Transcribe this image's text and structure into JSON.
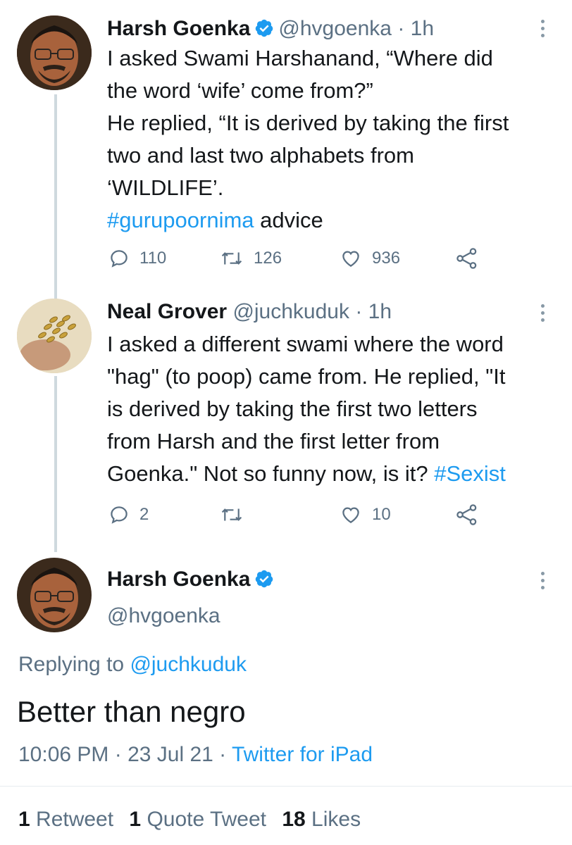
{
  "tweet1": {
    "name": "Harsh Goenka",
    "handle": "@hvgoenka",
    "time": "· 1h",
    "lines": [
      "I asked Swami Harshanand, “Where did",
      "the word ‘wife’ come from?”",
      "He replied, “It is derived by taking the first",
      "two and last two alphabets from",
      "‘WILDLIFE’."
    ],
    "hashtag": "#gurupoornima",
    "hashtag_after": " advice",
    "replies": "110",
    "retweets": "126",
    "likes": "936"
  },
  "tweet2": {
    "name": "Neal Grover",
    "handle": "@juchkuduk",
    "time": "· 1h",
    "lines": [
      "I asked a different swami where the word",
      "\"hag\" (to poop) came from. He replied, \"It",
      "is derived by taking the first two letters",
      "from Harsh and the first letter from"
    ],
    "last_line": "Goenka.\" Not so funny now, is it? ",
    "hashtag": "#Sexist",
    "replies": "2",
    "retweets": "",
    "likes": "10"
  },
  "main": {
    "name": "Harsh Goenka",
    "handle": "@hvgoenka",
    "replying_label": "Replying to ",
    "replying_handle": "@juchkuduk",
    "text": "Better than negro",
    "time": "10:06 PM",
    "date": " · 23 Jul 21 · ",
    "source": "Twitter for iPad",
    "retweet_count": "1",
    "retweet_label": " Retweet",
    "quote_count": "1",
    "quote_label": " Quote Tweet",
    "like_count": "18",
    "like_label": " Likes"
  },
  "colors": {
    "link": "#1d9bf0",
    "muted": "#5b7083",
    "thread": "#cfd9de"
  },
  "icons": [
    "verified-badge-icon",
    "reply-icon",
    "retweet-icon",
    "like-icon",
    "share-icon",
    "more-icon"
  ]
}
